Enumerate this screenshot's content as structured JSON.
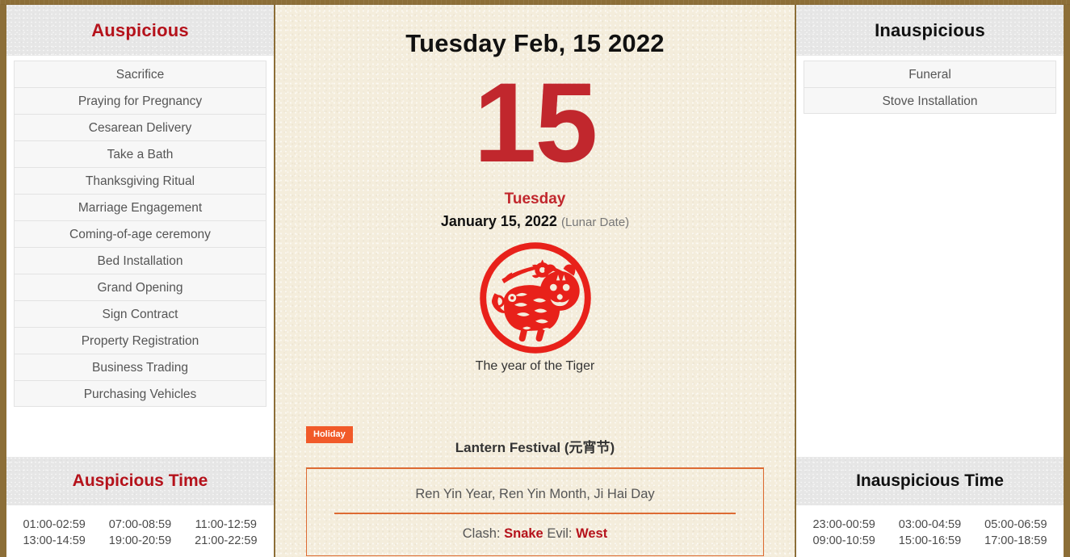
{
  "theme": {
    "border_brown": "#8c6e37",
    "paper_cream": "#f4eddc",
    "accent_red": "#c1272d",
    "header_red": "#b5121b",
    "holiday_orange": "#f15a29",
    "card_orange": "#dd6b33",
    "panel_gray": "#e6e6e6"
  },
  "left_panel": {
    "header": "Auspicious",
    "items": [
      "Sacrifice",
      "Praying for Pregnancy",
      "Cesarean Delivery",
      "Take a Bath",
      "Thanksgiving Ritual",
      "Marriage Engagement",
      "Coming-of-age ceremony",
      "Bed Installation",
      "Grand Opening",
      "Sign Contract",
      "Property Registration",
      "Business Trading",
      "Purchasing Vehicles"
    ],
    "time_header": "Auspicious Time",
    "times": [
      "01:00-02:59",
      "07:00-08:59",
      "11:00-12:59",
      "13:00-14:59",
      "19:00-20:59",
      "21:00-22:59"
    ]
  },
  "center_panel": {
    "title": "Tuesday Feb, 15 2022",
    "day_number": "15",
    "weekday": "Tuesday",
    "lunar_date": "January 15, 2022",
    "lunar_tag": "(Lunar Date)",
    "zodiac_caption": "The year of the Tiger",
    "zodiac_icon": "tiger-papercut-icon",
    "festival": {
      "badge": "Holiday",
      "name": "Lantern Festival (元宵节)",
      "ganzhi": "Ren Yin Year, Ren Yin Month, Ji Hai Day",
      "clash_label": "Clash:",
      "clash_value": "Snake",
      "evil_label": "Evil:",
      "evil_value": "West"
    }
  },
  "right_panel": {
    "header": "Inauspicious",
    "items": [
      "Funeral",
      "Stove Installation"
    ],
    "time_header": "Inauspicious Time",
    "times": [
      "23:00-00:59",
      "03:00-04:59",
      "05:00-06:59",
      "09:00-10:59",
      "15:00-16:59",
      "17:00-18:59"
    ]
  }
}
